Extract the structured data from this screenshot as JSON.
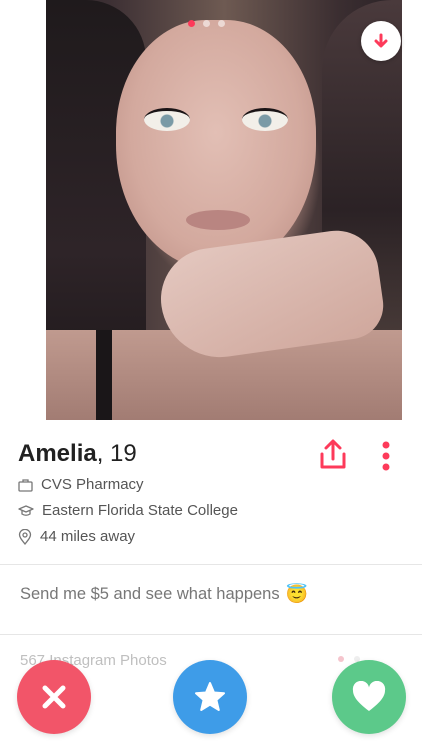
{
  "profile": {
    "name": "Amelia",
    "age_text": ", 19",
    "job": "CVS Pharmacy",
    "school": "Eastern Florida State College",
    "distance": "44 miles away"
  },
  "photo": {
    "indicator_count": 3,
    "active_index": 0,
    "down_button_icon": "arrow-down-icon"
  },
  "bio": {
    "text": "Send me $5 and see what happens",
    "emoji": "😇"
  },
  "instagram": {
    "label": "567 Instagram Photos"
  },
  "actions": {
    "nope_icon": "close-icon",
    "super_like_icon": "star-icon",
    "like_icon": "heart-icon"
  },
  "colors": {
    "accent": "#fd3a5a",
    "nope": "#f25569",
    "super_like": "#3e9ce8",
    "like": "#5cc98a"
  }
}
